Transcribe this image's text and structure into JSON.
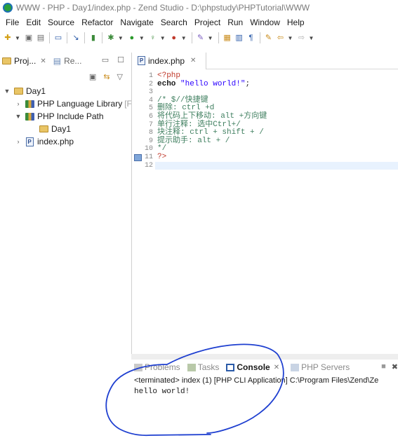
{
  "window": {
    "title": "WWW - PHP - Day1/index.php - Zend Studio - D:\\phpstudy\\PHPTutorial\\WWW"
  },
  "menubar": [
    "File",
    "Edit",
    "Source",
    "Refactor",
    "Navigate",
    "Search",
    "Project",
    "Run",
    "Window",
    "Help"
  ],
  "left_panel": {
    "tabs": [
      {
        "label": "Proj..."
      },
      {
        "label": "Re..."
      }
    ],
    "tree": [
      {
        "label": "Day1",
        "level": 0,
        "expanded": true,
        "icon": "folder-icon"
      },
      {
        "label": "PHP Language Library",
        "suffix": "[F",
        "level": 1,
        "expanded": false,
        "icon": "library-icon"
      },
      {
        "label": "PHP Include Path",
        "level": 1,
        "expanded": true,
        "icon": "library-icon"
      },
      {
        "label": "Day1",
        "level": 2,
        "icon": "folder-icon"
      },
      {
        "label": "index.php",
        "level": 1,
        "expanded": false,
        "icon": "php-file-icon"
      }
    ]
  },
  "editor": {
    "tab_label": "index.php",
    "line_numbers": [
      "1",
      "2",
      "3",
      "4",
      "5",
      "6",
      "7",
      "8",
      "9",
      "10",
      "11",
      "12"
    ],
    "lines": {
      "l1": "<?php",
      "l2_kw": "echo ",
      "l2_str": "\"hello world!\"",
      "l2_end": ";",
      "l4": "/* $//快捷键",
      "l5": "删除: ctrl +d",
      "l6": "将代码上下移动: alt +方向键",
      "l7": "单行注释: 选中Ctrl+/",
      "l8": "块注释: ctrl + shift + /",
      "l9": "提示助手: alt + /",
      "l10": "*/",
      "l11": "?>"
    }
  },
  "console": {
    "tabs": [
      {
        "label": "Problems",
        "active": false
      },
      {
        "label": "Tasks",
        "active": false
      },
      {
        "label": "Console",
        "active": true
      },
      {
        "label": "PHP Servers",
        "active": false
      }
    ],
    "status": "<terminated> index (1) [PHP CLI Application] C:\\Program Files\\Zend\\Ze",
    "output": "hello world!"
  },
  "colors": {
    "php_tag": "#c0392b",
    "string": "#2a00ff",
    "comment": "#3f7f5f",
    "annotation_ink": "#1e3fd0"
  }
}
